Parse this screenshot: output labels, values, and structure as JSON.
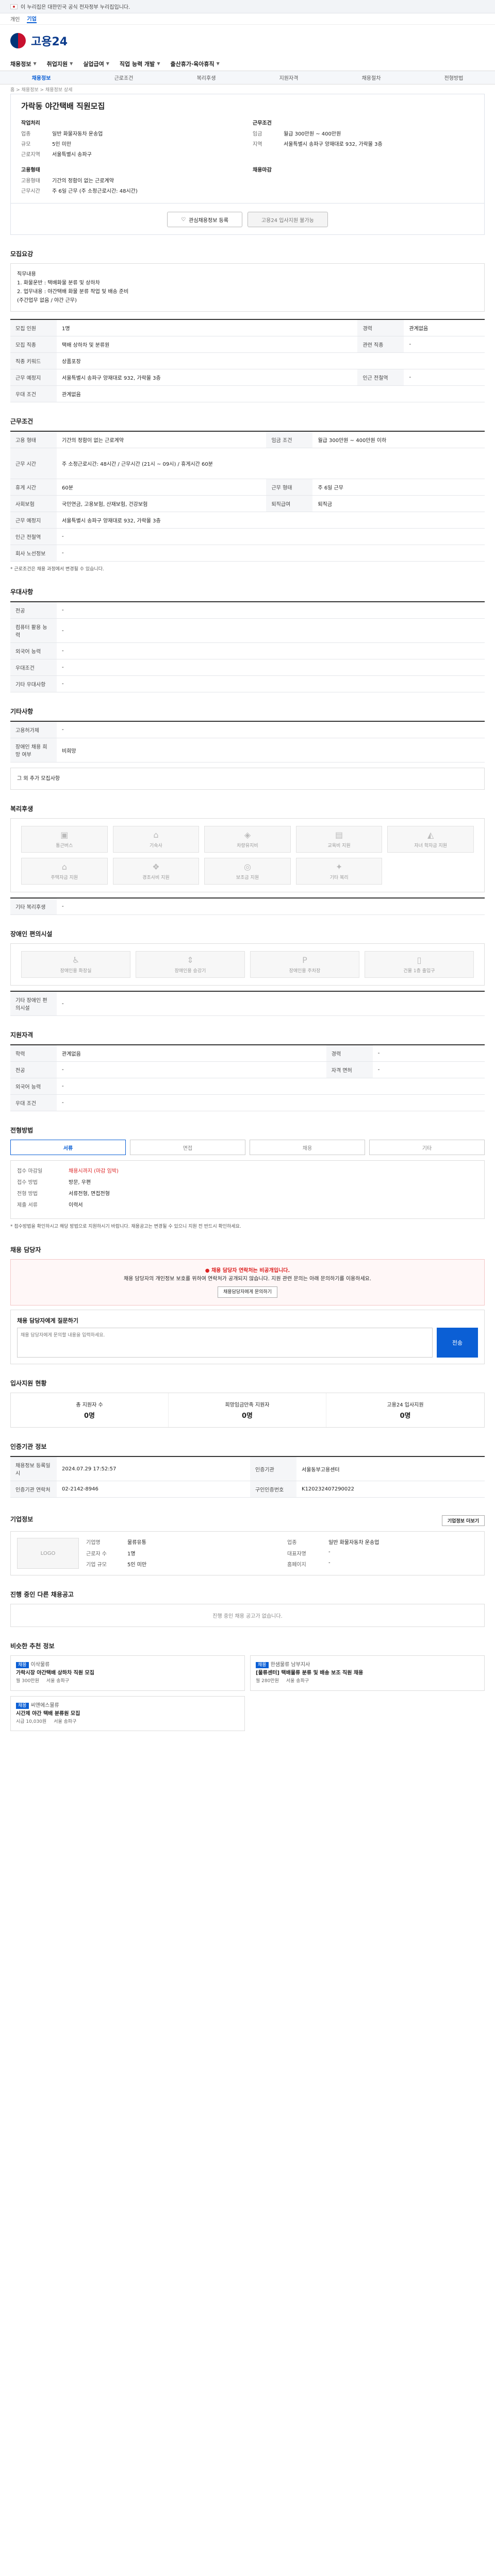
{
  "gov_banner": "이 누리집은 대한민국 공식 전자정부 누리집입니다.",
  "lang": [
    "개인",
    "기업"
  ],
  "logo": "고용24",
  "gnb": [
    "채용정보",
    "취업지원",
    "실업급여",
    "직업 능력 개발",
    "출산휴가·육아휴직"
  ],
  "subnav": [
    "채용정보",
    "근로조건",
    "복리후생",
    "지원자격",
    "채용절차",
    "전형방법"
  ],
  "breadcrumb": "홈 > 채용정보 > 채용정보 상세",
  "header": {
    "title": "가락동 야간택배 직원모집",
    "company_head": "작업처리",
    "company": [
      {
        "k": "업종",
        "v": "일반 화물자동차 운송업"
      },
      {
        "k": "규모",
        "v": "5인 미만"
      },
      {
        "k": "근로지역",
        "v": "서울특별시 송파구"
      }
    ],
    "cond_head": "근무조건",
    "cond": [
      {
        "k": "임금",
        "v": "월급 300만원 ~ 400만원"
      },
      {
        "k": "지역",
        "v": "서울특별시 송파구 양재대로 932, 가락몰 3층"
      }
    ],
    "qual_head": "고용형태",
    "qual": [
      {
        "k": "고용형태",
        "v": "기간의 정함이 없는 근로계약"
      },
      {
        "k": "근무시간",
        "v": "주 6일 근무 (주 소정근로시간: 48시간)"
      }
    ],
    "side_head": "채용마감",
    "btn_fav": "관심채용정보 등록",
    "btn_apply": "고용24 입사지원 불가능"
  },
  "sec_job": {
    "title": "모집요강",
    "desc_lines": [
      "직무내용",
      "1. 화물운반 : 택배화물 분류 및 상하차",
      "2. 업무내용 : 야간택배 화물 분류 작업 및 배송 준비",
      "(주간업무 없음 / 야간 근무)"
    ]
  },
  "job_table": [
    {
      "k": "모집 인원",
      "v": "1명",
      "k2": "경력",
      "v2": "관계없음"
    },
    {
      "k": "모집 직종",
      "v": "택배 상하차 및 분류원",
      "k2": "관련 직종",
      "v2": "-"
    },
    {
      "k": "직종 키워드",
      "v": "상품포장",
      "k2": "",
      "v2": ""
    },
    {
      "k": "근무 예정지",
      "v": "서울특별시 송파구 양재대로 932, 가락몰 3층",
      "k2": "인근 전철역",
      "v2": "-"
    },
    {
      "k": "우대 조건",
      "v": "관계없음",
      "k2": "",
      "v2": ""
    }
  ],
  "sec_cond": {
    "title": "근무조건"
  },
  "cond_table": [
    {
      "k": "고용 형태",
      "v": "기간의 정함이 없는 근로계약",
      "k2": "임금 조건",
      "v2": "월급 300만원 ~ 400만원 이하"
    },
    {
      "k": "근무 시간",
      "v": "주 소정근로시간: 48시간 / 근무시간 (21시 ~ 09시) / 휴게시간 60분",
      "k2": "",
      "v2": ""
    },
    {
      "k": "휴게 시간",
      "v": "60분",
      "k2": "근무 형태",
      "v2": "주 6일 근무"
    },
    {
      "k": "사회보험",
      "v": "국민연금, 고용보험, 산재보험, 건강보험",
      "k2": "퇴직급여",
      "v2": "퇴직금"
    },
    {
      "k": "근무 예정지",
      "v": "서울특별시 송파구 양재대로 932, 가락몰 3층",
      "k2": "",
      "v2": ""
    },
    {
      "k": "인근 전철역",
      "v": "-",
      "k2": "",
      "v2": ""
    },
    {
      "k": "회사 노선정보",
      "v": "-",
      "k2": "",
      "v2": ""
    }
  ],
  "cond_note": "* 근로조건은 채용 과정에서 변경될 수 있습니다.",
  "sec_pref": {
    "title": "우대사항"
  },
  "pref_table": [
    {
      "k": "전공",
      "v": "-"
    },
    {
      "k": "컴퓨터 활용 능력",
      "v": "-"
    },
    {
      "k": "외국어 능력",
      "v": "-"
    },
    {
      "k": "우대조건",
      "v": "-"
    },
    {
      "k": "기타 우대사항",
      "v": "-"
    }
  ],
  "sec_etc": {
    "title": "기타사항"
  },
  "etc_table": [
    {
      "k": "고용허가제",
      "v": "-"
    },
    {
      "k": "장애인 채용 희망 여부",
      "v": "비희망"
    }
  ],
  "etc_more": "그 외 추가 모집사항",
  "sec_welfare": {
    "title": "복리후생"
  },
  "welfare_icons": [
    "통근버스",
    "기숙사",
    "차량유지비",
    "교육비 지원",
    "자녀 학자금 지원",
    "주택자금 지원",
    "경조사비 지원",
    "보조금 지원",
    "기타 복리"
  ],
  "welfare_text_k": "기타 복리후생",
  "welfare_text_v": "-",
  "sec_disab": {
    "title": "장애인 편의시설"
  },
  "disab_icons": [
    "장애인용 화장실",
    "장애인용 승강기",
    "장애인용 주차장",
    "건물 1층 출입구"
  ],
  "disab_text_k": "기타 장애인 편의시설",
  "disab_text_v": "-",
  "sec_qual": {
    "title": "지원자격"
  },
  "qual_table": [
    {
      "k": "학력",
      "v": "관계없음",
      "k2": "경력",
      "v2": "-"
    },
    {
      "k": "전공",
      "v": "-",
      "k2": "자격 면허",
      "v2": "-"
    },
    {
      "k": "외국어 능력",
      "v": "-",
      "k2": "",
      "v2": ""
    },
    {
      "k": "우대 조건",
      "v": "-",
      "k2": "",
      "v2": ""
    }
  ],
  "sec_proc": {
    "title": "전형방법"
  },
  "proc_steps": [
    "서류",
    "면접",
    "채용",
    "기타"
  ],
  "proc_kv": [
    {
      "k": "접수 마감일",
      "v": "채용시까지 (마감 임박)"
    },
    {
      "k": "접수 방법",
      "v": "방문, 우편"
    },
    {
      "k": "전형 방법",
      "v": "서류전형, 면접전형"
    },
    {
      "k": "제출 서류",
      "v": "이력서"
    }
  ],
  "proc_note": "* 접수방법을 확인하시고 해당 방법으로 지원하시기 바랍니다. 채용공고는 변경될 수 있으니 지원 전 반드시 확인하세요.",
  "sec_mgr": {
    "title": "채용 담당자"
  },
  "mgr_warn": "채용 담당자 연락처는 비공개입니다.",
  "mgr_msg": "채용 담당자의 개인정보 보호를 위하여 연락처가 공개되지 않습니다. 지원 관련 문의는 아래 문의하기를 이용하세요.",
  "mgr_btn": "채용담당자에게 문의하기",
  "inq_label": "채용 담당자에게 질문하기",
  "inq_placeholder": "채용 담당자에게 문의할 내용을 입력하세요.",
  "inq_send": "전송",
  "sec_stat": {
    "title": "입사지원 현황"
  },
  "stats": [
    {
      "k": "총 지원자 수",
      "v": "0명"
    },
    {
      "k": "희망임금만족 지원자",
      "v": "0명"
    },
    {
      "k": "고용24 입사지원",
      "v": "0명"
    }
  ],
  "sec_info": {
    "title": "인증기관 정보"
  },
  "info_table": [
    {
      "k": "채용정보 등록일시",
      "v": "2024.07.29 17:52:57",
      "k2": "인증기관",
      "v2": "서울동부고용센터"
    },
    {
      "k": "인증기관 연락처",
      "v": "02-2142-8946",
      "k2": "구인인증번호",
      "v2": "K120232407290022"
    }
  ],
  "sec_company": {
    "title": "기업정보"
  },
  "company_logo": "LOGO",
  "company_info": [
    {
      "k": "기업명",
      "v": "물류유통"
    },
    {
      "k": "업종",
      "v": "일반 화물자동차 운송업"
    },
    {
      "k": "근로자 수",
      "v": "1명"
    },
    {
      "k": "대표자명",
      "v": "-"
    },
    {
      "k": "기업 규모",
      "v": "5인 미만"
    },
    {
      "k": "홈페이지",
      "v": "-"
    }
  ],
  "company_btn": "기업정보 더보기",
  "sec_others": {
    "title": "진행 중인 다른 채용공고"
  },
  "others_empty": "진행 중인 채용 공고가 없습니다.",
  "sec_similar": {
    "title": "비슷한 추천 정보"
  },
  "cards": [
    {
      "co": "이삭물류",
      "title": "가락시장 야간택배 상하차 직원 모집",
      "pay": "월 300만원",
      "place": "서울 송파구"
    },
    {
      "co": "한샘물류 남부지사",
      "title": "[물류센터] 택배물류 분류 및 배송 보조 직원 채용",
      "pay": "월 280만원",
      "place": "서울 송파구"
    },
    {
      "co": "씨앤에스물류",
      "title": "시간제 야간 택배 분류원 모집",
      "pay": "시급 10,030원",
      "place": "서울 송파구"
    }
  ]
}
